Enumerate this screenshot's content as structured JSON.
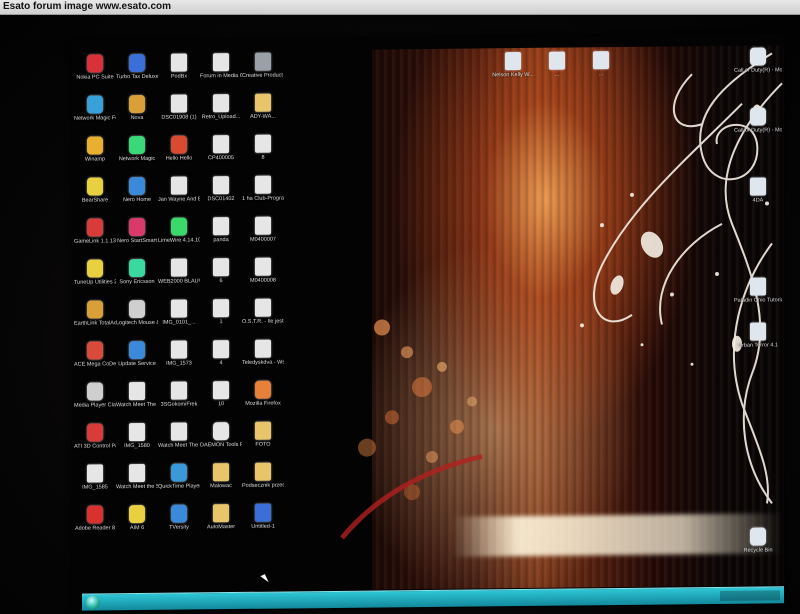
{
  "banner": {
    "text": "Esato forum image www.esato.com"
  },
  "desktop": {
    "icons_left": [
      {
        "label": "Nokia PC Suite",
        "kind": "app",
        "color": "#d9303a"
      },
      {
        "label": "Turbo Tax Deluxe 2007",
        "kind": "app",
        "color": "#3a6fd9"
      },
      {
        "label": "PodBx",
        "kind": "file",
        "color": "#e6e6e6"
      },
      {
        "label": "Forum in Media Center",
        "kind": "file",
        "color": "#e6e6e6"
      },
      {
        "label": "Creative Product Reg...",
        "kind": "file",
        "color": "#9aa0a8"
      },
      {
        "label": "Network Magic Folders",
        "kind": "app",
        "color": "#3aa0d9"
      },
      {
        "label": "Nova",
        "kind": "app",
        "color": "#d9a03a"
      },
      {
        "label": "DSC01908 (1)",
        "kind": "file",
        "color": "#e6e6e6"
      },
      {
        "label": "Retro_Upload...",
        "kind": "file",
        "color": "#e6e6e6"
      },
      {
        "label": "ADY-WA...",
        "kind": "folder",
        "color": "#e8c56a"
      },
      {
        "label": "Winamp",
        "kind": "app",
        "color": "#e8b030"
      },
      {
        "label": "Network Magic",
        "kind": "app",
        "color": "#3ad978"
      },
      {
        "label": "Hello Hello",
        "kind": "app",
        "color": "#d94a30"
      },
      {
        "label": "CP400005",
        "kind": "file",
        "color": "#e6e6e6"
      },
      {
        "label": "8",
        "kind": "file",
        "color": "#e6e6e6"
      },
      {
        "label": "BearShare",
        "kind": "app",
        "color": "#e8d040"
      },
      {
        "label": "Nero Home",
        "kind": "app",
        "color": "#3a8ad9"
      },
      {
        "label": "Jan Wayne And Blod...",
        "kind": "file",
        "color": "#e6e6e6"
      },
      {
        "label": "DSC01402",
        "kind": "file",
        "color": "#e6e6e6"
      },
      {
        "label": "1 ha Club-Program...",
        "kind": "file",
        "color": "#e6e6e6"
      },
      {
        "label": "GameLink 1.1.13",
        "kind": "app",
        "color": "#d93a3a"
      },
      {
        "label": "Nero StartSmart",
        "kind": "app",
        "color": "#d93a6a"
      },
      {
        "label": "LimeWire 4.14.10",
        "kind": "app",
        "color": "#3ad96a"
      },
      {
        "label": "panda",
        "kind": "file",
        "color": "#e6e6e6"
      },
      {
        "label": "M0400007",
        "kind": "file",
        "color": "#e6e6e6"
      },
      {
        "label": "TuneUp Utilities 2006",
        "kind": "app",
        "color": "#e8d040"
      },
      {
        "label": "Sony Ericsson",
        "kind": "app",
        "color": "#3ad9a0"
      },
      {
        "label": "WEB2000 BLAUV...",
        "kind": "file",
        "color": "#e6e6e6"
      },
      {
        "label": "6",
        "kind": "file",
        "color": "#e6e6e6"
      },
      {
        "label": "M0400008",
        "kind": "file",
        "color": "#e6e6e6"
      },
      {
        "label": "EarthLink TotalAccess",
        "kind": "app",
        "color": "#d9a03a"
      },
      {
        "label": "Logitech Mouse & Keybd",
        "kind": "app",
        "color": "#cfcfcf"
      },
      {
        "label": "IMG_0101_...",
        "kind": "file",
        "color": "#e6e6e6"
      },
      {
        "label": "1",
        "kind": "file",
        "color": "#e6e6e6"
      },
      {
        "label": "O.S.T.R. - Ile jestem w s...",
        "kind": "file",
        "color": "#e6e6e6"
      },
      {
        "label": "ACE Mega CoDecS P...",
        "kind": "app",
        "color": "#d94a3a"
      },
      {
        "label": "Update Service",
        "kind": "app",
        "color": "#3a8ad9"
      },
      {
        "label": "IMG_1573",
        "kind": "file",
        "color": "#e6e6e6"
      },
      {
        "label": "4",
        "kind": "file",
        "color": "#e6e6e6"
      },
      {
        "label": "Teledyskdva - Wshiga ajki",
        "kind": "file",
        "color": "#e6e6e6"
      },
      {
        "label": "Media Player Classic",
        "kind": "app",
        "color": "#cfcfcf"
      },
      {
        "label": "Watch Meet The Sport...",
        "kind": "file",
        "color": "#e6e6e6"
      },
      {
        "label": "3SGokomiFrek",
        "kind": "file",
        "color": "#e6e6e6"
      },
      {
        "label": "10",
        "kind": "file",
        "color": "#e6e6e6"
      },
      {
        "label": "Mozilla Firefox",
        "kind": "app",
        "color": "#e8803a"
      },
      {
        "label": "ATI 3D Control Panel",
        "kind": "app",
        "color": "#d93a3a"
      },
      {
        "label": "IMG_1580",
        "kind": "file",
        "color": "#e6e6e6"
      },
      {
        "label": "Watch Meet The Sport...",
        "kind": "file",
        "color": "#e6e6e6"
      },
      {
        "label": "DAEMON Tools Pro",
        "kind": "app",
        "color": "#e6e6e6"
      },
      {
        "label": "FOTO",
        "kind": "folder",
        "color": "#e8c56a"
      },
      {
        "label": "IMG_1585",
        "kind": "file",
        "color": "#e6e6e6"
      },
      {
        "label": "Watch Meet the Sport...",
        "kind": "file",
        "color": "#e6e6e6"
      },
      {
        "label": "QuickTime Player",
        "kind": "app",
        "color": "#3a9ad9"
      },
      {
        "label": "Malowac",
        "kind": "folder",
        "color": "#e8c56a"
      },
      {
        "label": "Podsecznik przedmo...",
        "kind": "folder",
        "color": "#e8c56a"
      },
      {
        "label": "Adobe Reader 8",
        "kind": "app",
        "color": "#d93030"
      },
      {
        "label": "AIM 6",
        "kind": "app",
        "color": "#e8d040"
      },
      {
        "label": "TVersity",
        "kind": "app",
        "color": "#3a8ad9"
      },
      {
        "label": "AutoMaster",
        "kind": "folder",
        "color": "#e8c56a"
      },
      {
        "label": "Untitled-1",
        "kind": "file",
        "color": "#3a6fd9"
      }
    ],
    "icons_top": [
      {
        "label": "Nelson Kelly W...",
        "kind": "file"
      },
      {
        "label": "...",
        "kind": "file"
      },
      {
        "label": "...",
        "kind": "file"
      }
    ],
    "icons_right": [
      {
        "label": "Call of Duty(R) - Modern...",
        "kind": "app"
      },
      {
        "label": "Call of Duty(R) - Modern...",
        "kind": "app"
      },
      {
        "label": "4DA",
        "kind": "file"
      },
      {
        "label": "Paladin Ohio Tutorial...",
        "kind": "folder"
      },
      {
        "label": "Urban Terror 4.1",
        "kind": "folder"
      },
      {
        "label": "Recycle Bin",
        "kind": "app"
      }
    ]
  }
}
